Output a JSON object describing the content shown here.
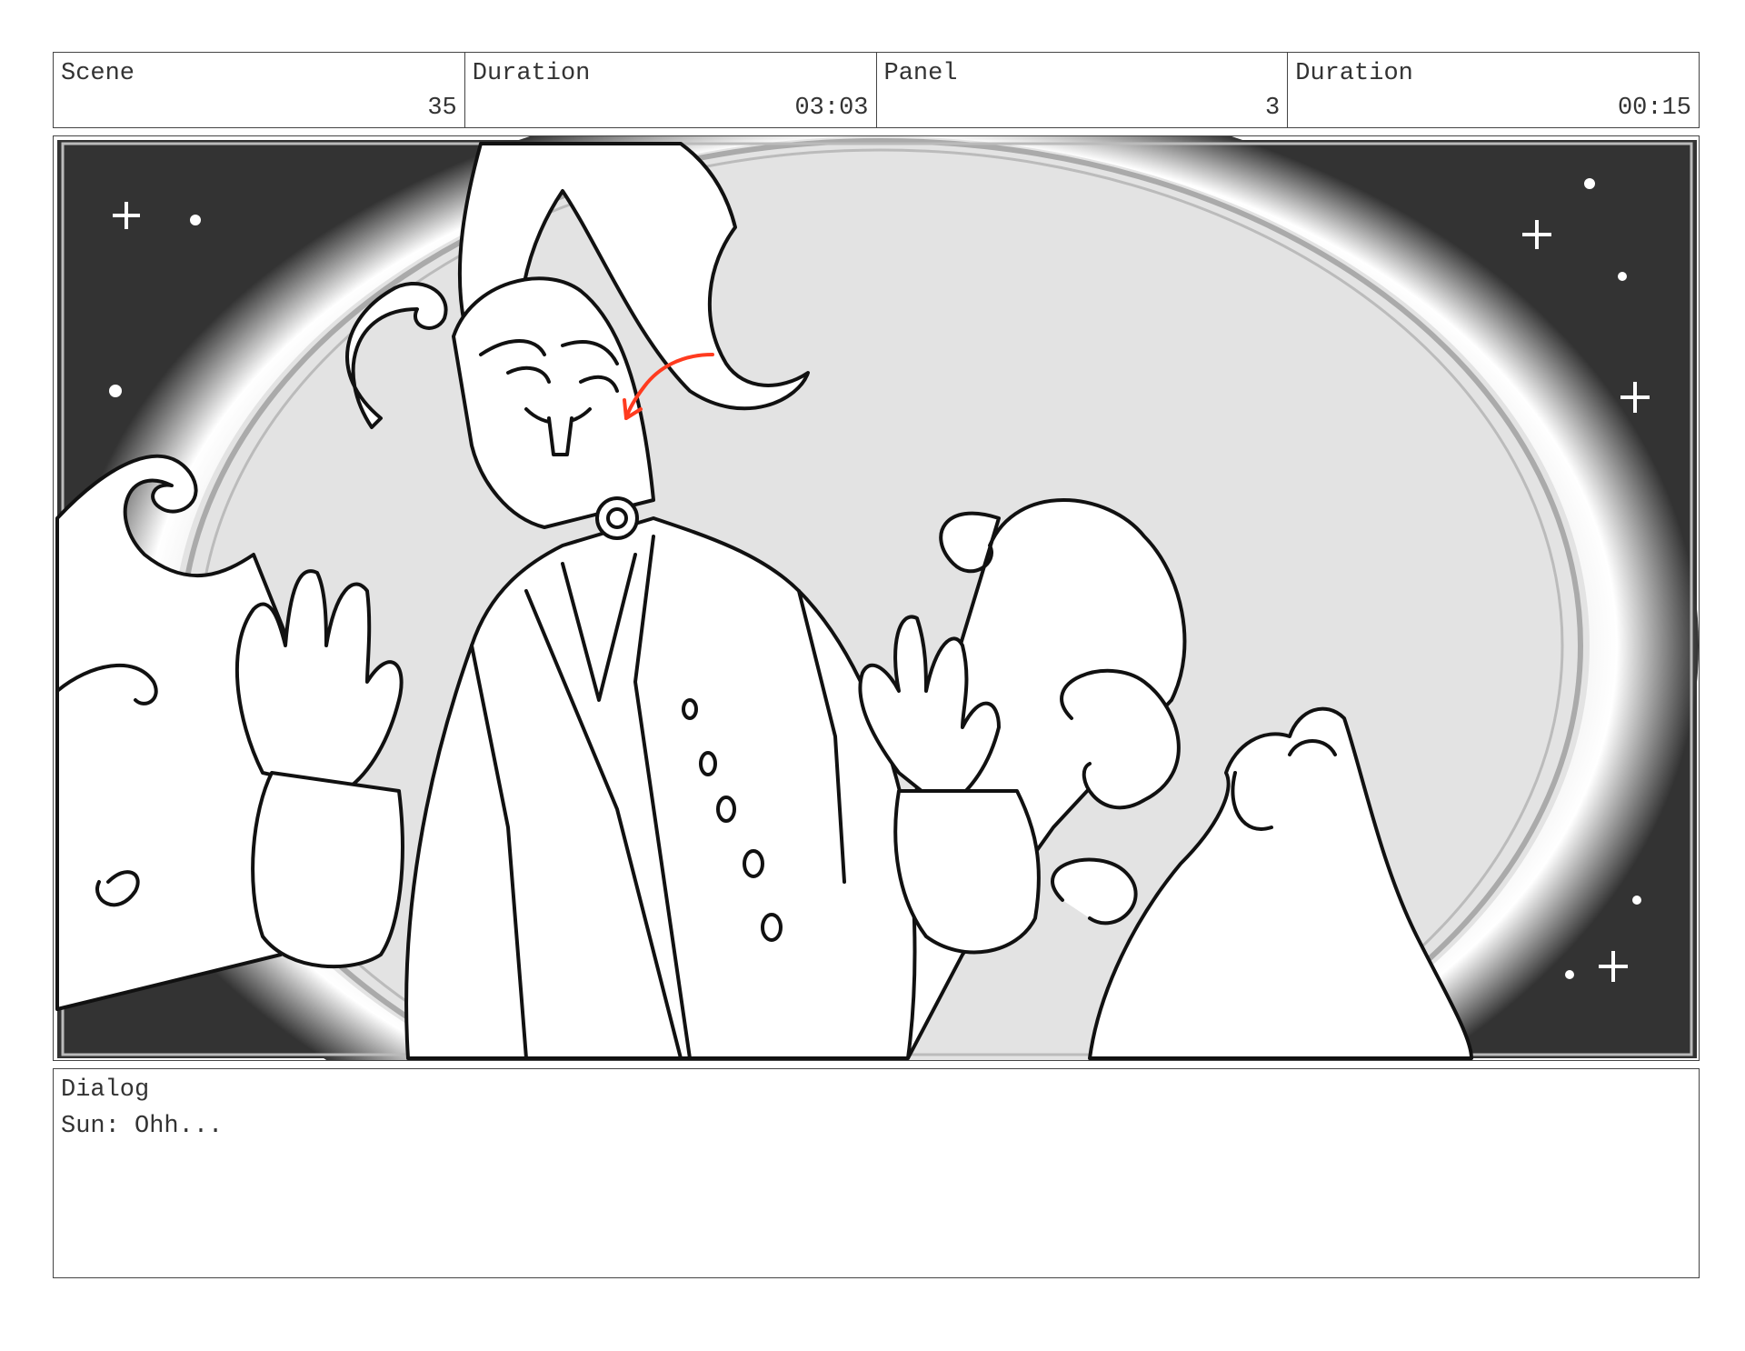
{
  "header": {
    "scene": {
      "label": "Scene",
      "value": "35"
    },
    "scene_duration": {
      "label": "Duration",
      "value": "03:03"
    },
    "panel": {
      "label": "Panel",
      "value": "3"
    },
    "panel_duration": {
      "label": "Duration",
      "value": "00:15"
    }
  },
  "dialog": {
    "label": "Dialog",
    "text": "Sun: Ohh..."
  },
  "colors": {
    "ink": "#111111",
    "sky": "#333333",
    "moon": "#e3e3e3",
    "rim": "#aaaaaa",
    "annotation": "#ff3b1f"
  }
}
